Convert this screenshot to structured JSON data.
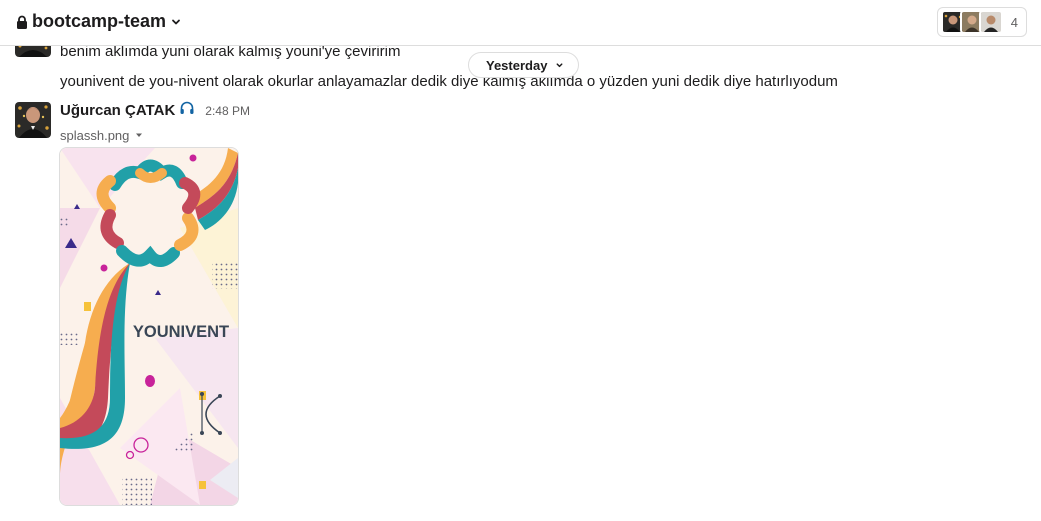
{
  "header": {
    "channel_name": "bootcamp-team",
    "member_count": "4"
  },
  "messages": {
    "previous_line_1": "benim aklımda yuni olarak kalmış youni'ye çeviririm",
    "previous_line_2": "younivent de you-nivent olarak okurlar anlayamazlar dedik diye kalmış aklımda o yüzden yuni dedik diye hatırlıyodum",
    "date_divider": "Yesterday",
    "author_name": "Uğurcan ÇATAK",
    "time": "2:48 PM",
    "file_name": "splassh.png",
    "image_text": "YOUNIVENT"
  },
  "colors": {
    "text": "#1d1c1d",
    "muted": "#616061",
    "border": "#dddddd",
    "ribbon_teal": "#21a0a8",
    "ribbon_red": "#c44a5a",
    "ribbon_orange": "#f6ad4f",
    "logo_text": "#3a4656"
  },
  "icons": {
    "lock": "lock-icon",
    "chevron": "chevron-down-icon",
    "headphones": "headphones-icon",
    "file_menu": "caret-down-icon"
  }
}
